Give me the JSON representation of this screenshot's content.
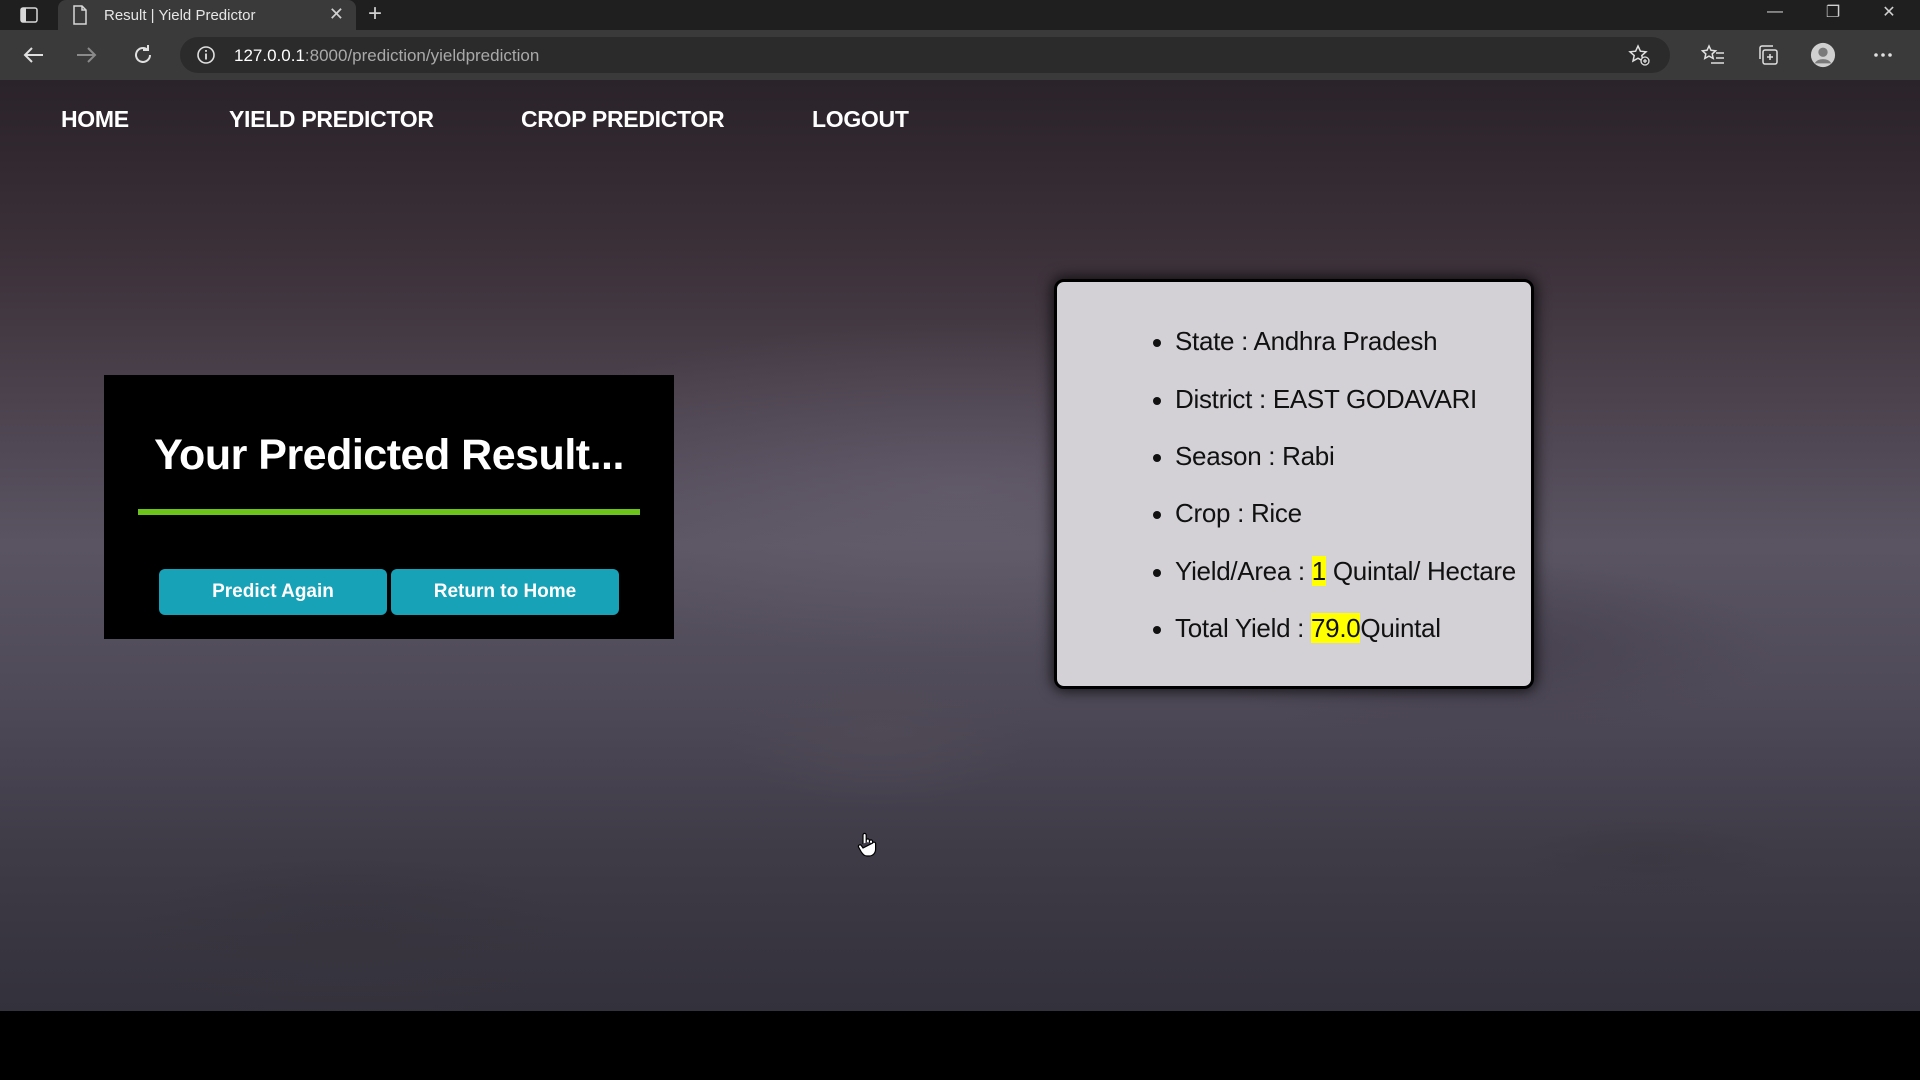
{
  "browser": {
    "tab_title": "Result | Yield Predictor",
    "tab_close": "✕",
    "new_tab": "+",
    "url_host": "127.0.0.1",
    "url_path": ":8000/prediction/yieldprediction",
    "window_controls": {
      "minimize": "—",
      "restore": "❐",
      "close": "✕"
    }
  },
  "nav": {
    "home": "HOME",
    "yield_predictor": "YIELD PREDICTOR",
    "crop_predictor": "CROP PREDICTOR",
    "logout": "LOGOUT"
  },
  "result": {
    "heading": "Your Predicted Result...",
    "predict_again": "Predict Again",
    "return_home": "Return to Home"
  },
  "details": {
    "state_label": "State : ",
    "state": "Andhra Pradesh",
    "district_label": "District : ",
    "district": "EAST GODAVARI",
    "season_label": "Season : ",
    "season": "Rabi",
    "crop_label": "Crop : ",
    "crop": "Rice",
    "yield_area_label": "Yield/Area : ",
    "yield_area_value": "1",
    "yield_area_unit": " Quintal/ Hectare",
    "total_yield_label": "Total Yield : ",
    "total_yield_value": "79.0",
    "total_yield_unit": "Quintal"
  },
  "colors": {
    "button": "#17a2b8",
    "divider": "#6cc41a",
    "highlight": "#ffff00"
  }
}
